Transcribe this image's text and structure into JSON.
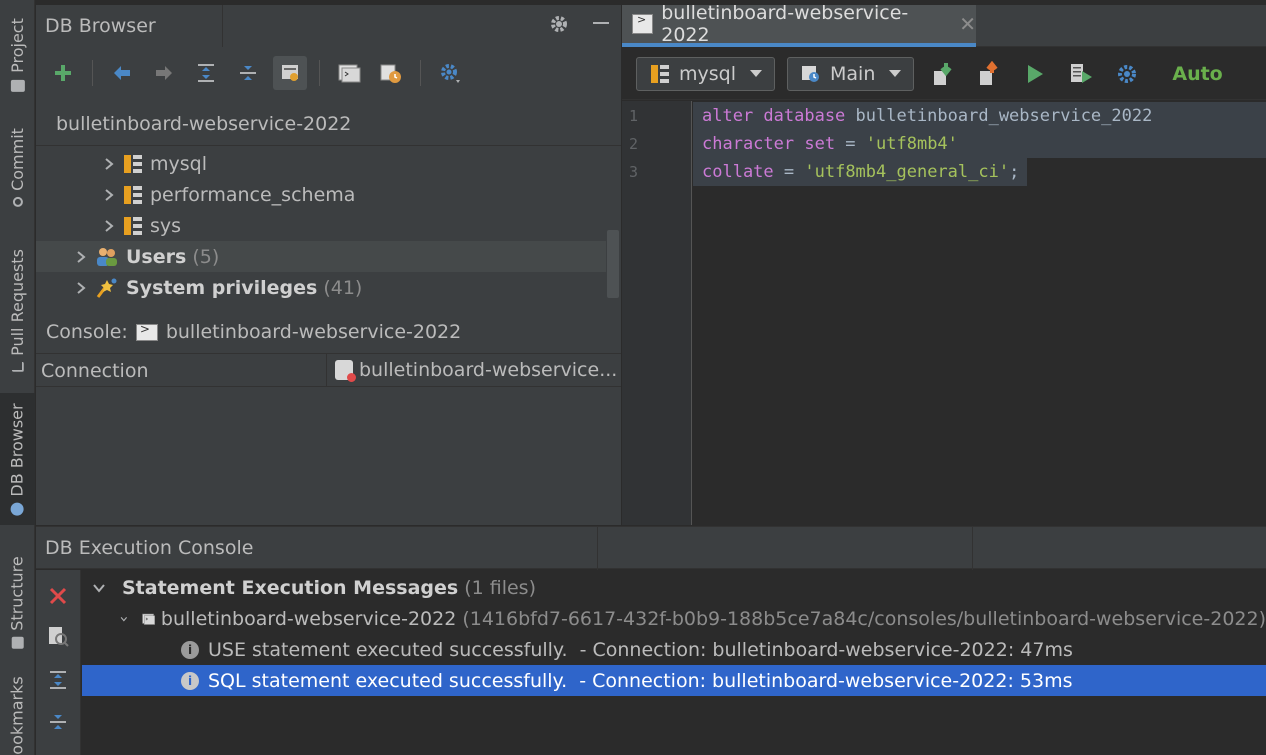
{
  "left_strip": {
    "tabs": [
      {
        "label": "Project"
      },
      {
        "label": "Commit"
      },
      {
        "label": "Pull Requests"
      },
      {
        "label": "DB Browser"
      },
      {
        "label": "Structure"
      },
      {
        "label": "ookmarks"
      }
    ]
  },
  "db_browser": {
    "title": "DB Browser",
    "connection": "bulletinboard-webservice-2022",
    "tree": [
      {
        "label": "mysql",
        "type": "schema"
      },
      {
        "label": "performance_schema",
        "type": "schema"
      },
      {
        "label": "sys",
        "type": "schema"
      },
      {
        "label": "Users",
        "count": "(5)",
        "type": "users"
      },
      {
        "label": "System privileges",
        "count": "(41)",
        "type": "privileges"
      }
    ],
    "console_label": "Console:",
    "console_value": "bulletinboard-webservice-2022",
    "property": {
      "key": "Connection",
      "value": "bulletinboard-webservice..."
    }
  },
  "editor": {
    "tab_label": "bulletinboard-webservice-2022",
    "schema_combo": "mysql",
    "session_combo": "Main",
    "auto_label": "Auto",
    "line_numbers": [
      "1",
      "2",
      "3"
    ],
    "code": {
      "l1_kw": "alter database",
      "l1_id": " bulletinboard_webservice_2022",
      "l2_kw": "character set",
      "l2_op": " = ",
      "l2_str": "'utf8mb4'",
      "l3_kw": "collate",
      "l3_op": " = ",
      "l3_str": "'utf8mb4_general_ci'",
      "l3_end": ";"
    }
  },
  "exec_console": {
    "title": "DB Execution Console",
    "root_label": "Statement Execution Messages",
    "root_count": "(1 files)",
    "file_label": "bulletinboard-webservice-2022",
    "file_path": "(1416bfd7-6617-432f-b0b9-188b5ce7a84c/consoles/bulletinboard-webservice-2022)",
    "messages": [
      {
        "text": "USE statement executed successfully.",
        "detail": "  - Connection: bulletinboard-webservice-2022: 47ms"
      },
      {
        "text": "SQL statement executed successfully.",
        "detail": "  - Connection: bulletinboard-webservice-2022: 53ms"
      }
    ]
  },
  "colors": {
    "accent": "#4a88c7",
    "selection": "#2f65ca",
    "keyword": "#cc7ad6",
    "string": "#a5c25c",
    "run_green": "#59a869",
    "error_red": "#e04a4a"
  }
}
